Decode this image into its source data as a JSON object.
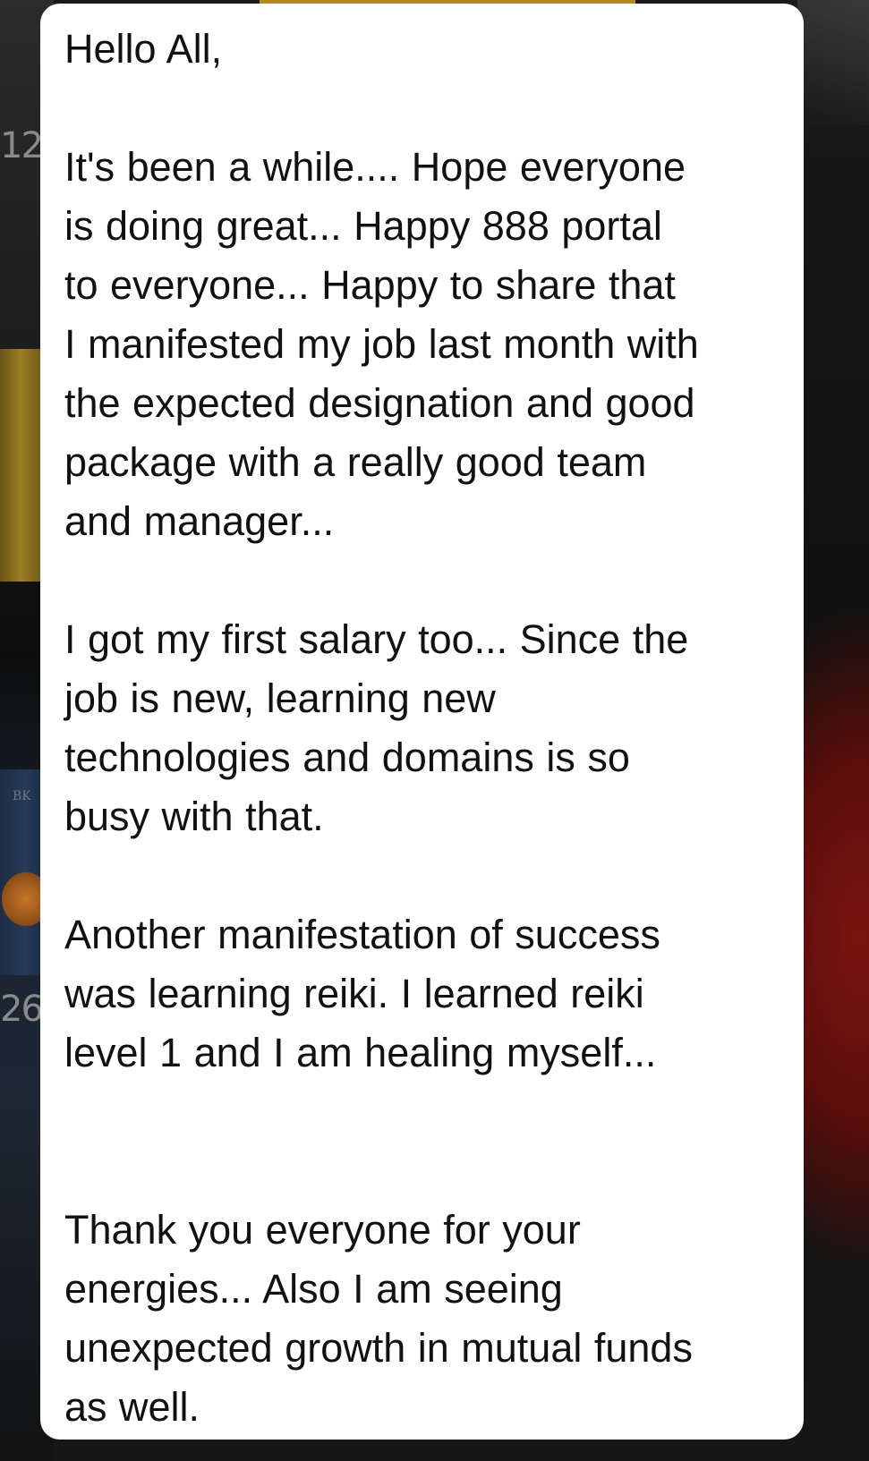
{
  "background": {
    "shelf_numbers": [
      "12",
      "26"
    ],
    "shelf_label": "BK"
  },
  "message": {
    "greeting": "Hello All,",
    "paragraph_1": "It's been a while.... Hope everyone\nis doing great... Happy 888 portal\nto everyone... Happy to share that\nI manifested my job last month with\nthe expected designation and good\npackage with a really good team\nand manager...",
    "paragraph_2": "I got my first salary too... Since the\njob is new, learning new\ntechnologies and domains is so\nbusy with that.",
    "paragraph_3": "Another manifestation of success\nwas learning reiki. I learned reiki\nlevel 1 and I am healing myself...",
    "paragraph_4": "Thank you everyone for your\nenergies... Also I am seeing\nunexpected growth in mutual funds\nas well."
  }
}
